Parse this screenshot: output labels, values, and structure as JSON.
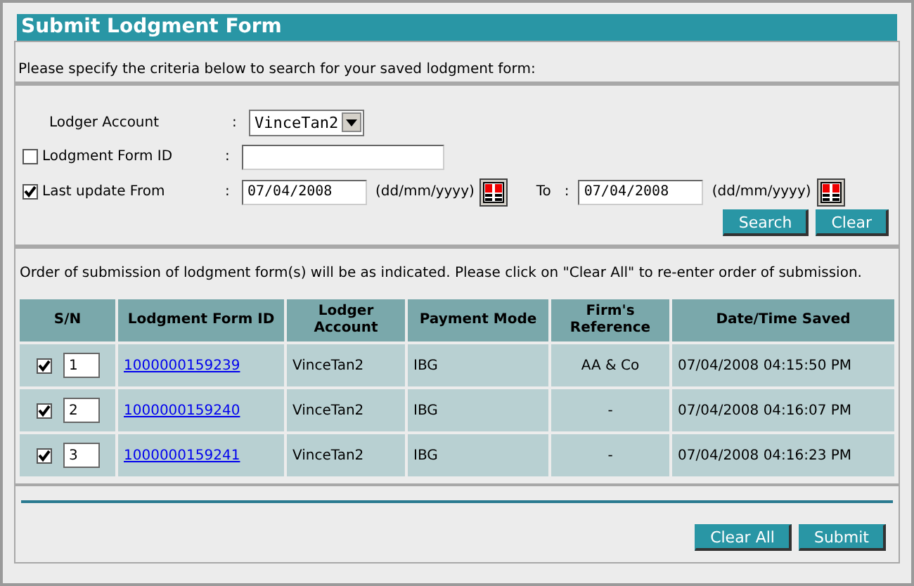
{
  "title": "Submit Lodgment Form",
  "instructions": "Please specify the criteria below to search for your saved lodgment form:",
  "criteria": {
    "account": {
      "label": "Lodger Account",
      "value": "VinceTan2"
    },
    "form_id": {
      "label": "Lodgment Form ID",
      "checked": false
    },
    "last_update": {
      "label": "Last update From",
      "checked": true,
      "from": "07/04/2008",
      "from_hint": "(dd/mm/yyyy)",
      "to_label": "To",
      "to": "07/04/2008",
      "to_hint": "(dd/mm/yyyy)"
    },
    "separator": ":"
  },
  "search_buttons": [
    "Search",
    "Clear"
  ],
  "order_note": "Order of submission of lodgment form(s) will be as indicated. Please click on \"Clear All\" to re-enter order of submission.",
  "table": {
    "columns": [
      "S/N",
      "Lodgment Form ID",
      "Lodger Account",
      "Payment Mode",
      "Firm's Reference",
      "Date/Time Saved"
    ],
    "rows": [
      {
        "checked": true,
        "sn": "1",
        "id": "1000000159239",
        "account": "VinceTan2",
        "mode": "IBG",
        "ref": "AA & Co",
        "saved": "07/04/2008 04:15:50 PM"
      },
      {
        "checked": true,
        "sn": "2",
        "id": "1000000159240",
        "account": "VinceTan2",
        "mode": "IBG",
        "ref": "-",
        "saved": "07/04/2008 04:16:07 PM"
      },
      {
        "checked": true,
        "sn": "3",
        "id": "1000000159241",
        "account": "VinceTan2",
        "mode": "IBG",
        "ref": "-",
        "saved": "07/04/2008 04:16:23 PM"
      }
    ]
  },
  "footer_buttons": [
    "Clear All",
    "Submit"
  ]
}
